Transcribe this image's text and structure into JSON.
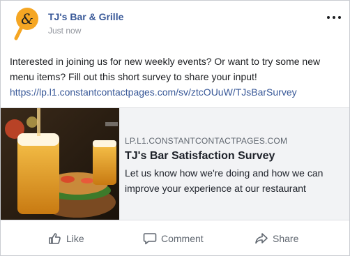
{
  "post": {
    "page_name": "TJ's Bar & Grille",
    "timestamp": "Just now",
    "text_line_1": "Interested in joining us for new weekly events? Or want to try some new",
    "text_line_2": "menu items? Fill out this short survey to share your input!",
    "link": "https://lp.l1.constantcontactpages.com/sv/ztcOUuW/TJsBarSurvey"
  },
  "preview": {
    "domain": "LP.L1.CONSTANTCONTACTPAGES.COM",
    "title": "TJ's Bar Satisfaction Survey",
    "desc_line_1": "Let us know how we're doing and how we can",
    "desc_line_2": "improve your experience at our restaurant"
  },
  "actions": {
    "like": "Like",
    "comment": "Comment",
    "share": "Share"
  },
  "icons": {
    "avatar": "ampersand-logo-icon",
    "more": "more-options-icon",
    "like": "thumbs-up-icon",
    "comment": "comment-bubble-icon",
    "share": "share-arrow-icon"
  },
  "colors": {
    "brand_orange": "#f5a623",
    "link_blue": "#385898",
    "muted_text": "#606770"
  }
}
